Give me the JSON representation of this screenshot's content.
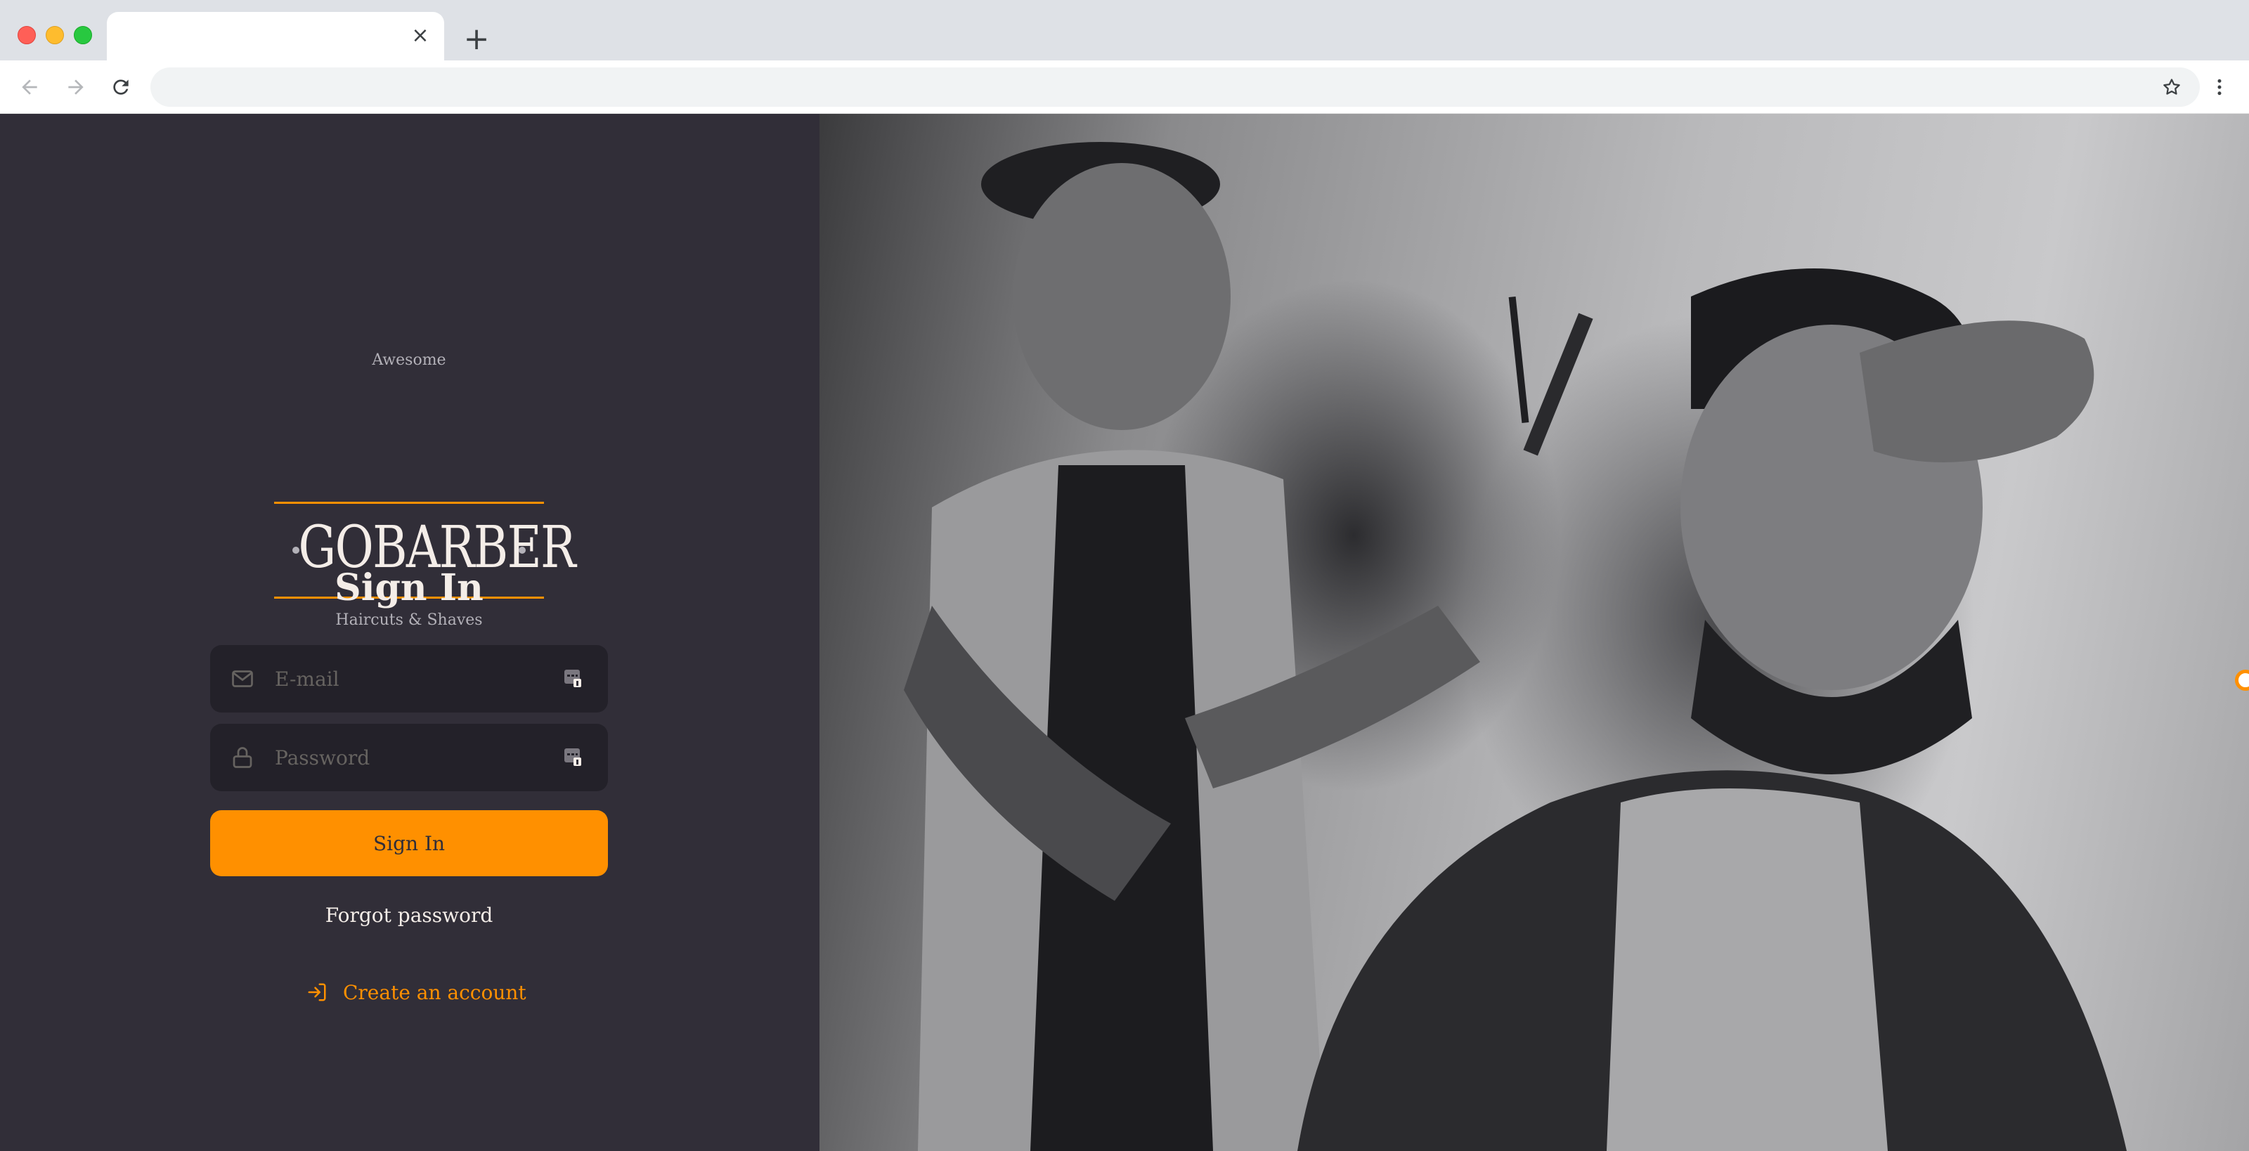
{
  "browser": {
    "tab_title": "",
    "tab_close_label": "×",
    "new_tab_label": "+",
    "address": "",
    "icons": [
      "back-arrow-icon",
      "forward-arrow-icon",
      "reload-icon",
      "star-icon",
      "menu-dots-icon"
    ]
  },
  "logo": {
    "top_text": "Awesome",
    "name": "GOBARBER",
    "sub_text": "Haircuts & Shaves"
  },
  "form": {
    "title": "Sign In",
    "email_placeholder": "E-mail",
    "email_value": "",
    "password_placeholder": "Password",
    "password_value": "",
    "submit_label": "Sign In",
    "forgot_label": "Forgot password"
  },
  "signup": {
    "label": "Create an account",
    "icon": "log-in-icon"
  },
  "colors": {
    "accent": "#ff9000",
    "panel": "#312e38",
    "input_bg": "#232129",
    "text": "#f4ede8",
    "muted": "#666360"
  }
}
